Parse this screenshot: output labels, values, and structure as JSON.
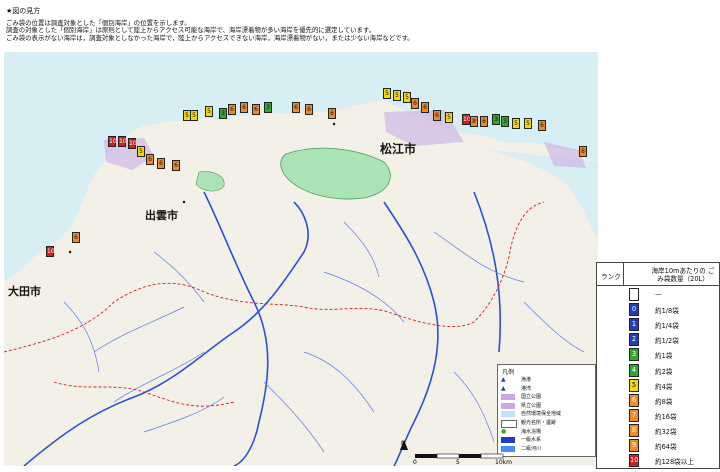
{
  "notes": {
    "heading": "★図の見方",
    "lines": [
      "ごみ袋の位置は調査対象とした「個別海岸」の位置を示します。",
      "調査の対象とした「個別海岸」は原則として陸上からアクセス可能な海岸で、海岸漂着物が多い海岸を優先的に選定しています。",
      "ごみ袋の表示がない海岸は，調査対象としなかった海岸で，陸上からアクセスできない海岸，海岸漂着物がない，または少ない海岸などです。"
    ]
  },
  "map": {
    "cities": {
      "matsue": "松江市",
      "izumo": "出雲市",
      "oda": "大田市"
    },
    "marker_values": [
      "10",
      "10",
      "10",
      "5",
      "6",
      "6",
      "6",
      "5",
      "5",
      "5",
      "3",
      "6",
      "6",
      "6",
      "3",
      "6",
      "6",
      "6",
      "5",
      "5",
      "5",
      "6",
      "6",
      "6",
      "5",
      "10",
      "8",
      "6",
      "3",
      "3",
      "5",
      "5",
      "6",
      "8",
      "6",
      "10"
    ]
  },
  "legend": {
    "rank_header": "ランク",
    "unit_header": "海岸10mあたりの ごみ袋数量（20L）",
    "rows": [
      {
        "rank": "",
        "label": "—",
        "color": "#ffffff"
      },
      {
        "rank": "0",
        "label": "約1/8袋",
        "color": "#1f3fbf"
      },
      {
        "rank": "1",
        "label": "約1/4袋",
        "color": "#1f3fbf"
      },
      {
        "rank": "2",
        "label": "約1/2袋",
        "color": "#1f3fbf"
      },
      {
        "rank": "3",
        "label": "約1袋",
        "color": "#2fa82f"
      },
      {
        "rank": "4",
        "label": "約2袋",
        "color": "#2fa82f"
      },
      {
        "rank": "5",
        "label": "約4袋",
        "color": "#f5d800"
      },
      {
        "rank": "6",
        "label": "約8袋",
        "color": "#f08a24"
      },
      {
        "rank": "7",
        "label": "約16袋",
        "color": "#f08a24"
      },
      {
        "rank": "8",
        "label": "約32袋",
        "color": "#f08a24"
      },
      {
        "rank": "9",
        "label": "約64袋",
        "color": "#f08a24"
      },
      {
        "rank": "10",
        "label": "約128袋以上",
        "color": "#d21f1f"
      }
    ]
  },
  "inset_legend": {
    "title": "凡例",
    "rows": [
      {
        "label": "漁港",
        "color": "#1f3fbf",
        "prefix": "▲"
      },
      {
        "label": "港湾",
        "color": "#1f3fbf",
        "prefix": "▲"
      },
      {
        "label": "国立公園",
        "color": "#c8a8e6",
        "prefix": ""
      },
      {
        "label": "県立公園",
        "color": "#c8a8e6",
        "prefix": ""
      },
      {
        "label": "自然環境保全地域",
        "color": "#bfe3ff",
        "prefix": ""
      },
      {
        "label": "観光名所・遺跡",
        "color": "#ffffff",
        "prefix": ""
      },
      {
        "label": "海水浴場",
        "color": "#2fa82f",
        "prefix": "●"
      },
      {
        "label": "一級水系",
        "color": "#1f3fbf",
        "prefix": ""
      },
      {
        "label": "二級河川",
        "color": "#4a8cff",
        "prefix": ""
      }
    ]
  },
  "scale": {
    "labels": [
      "0",
      "5",
      "10km"
    ],
    "north": "N"
  }
}
